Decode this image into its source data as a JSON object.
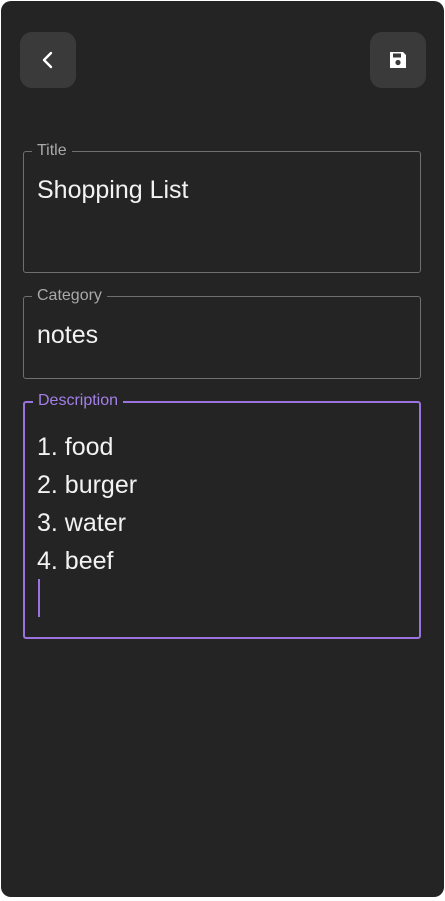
{
  "header": {
    "back_icon": "chevron-left-icon",
    "save_icon": "floppy-disk-icon"
  },
  "form": {
    "title": {
      "label": "Title",
      "value": "Shopping List"
    },
    "category": {
      "label": "Category",
      "value": "notes"
    },
    "description": {
      "label": "Description",
      "lines": [
        "1. food",
        "2. burger",
        "3. water",
        "4. beef"
      ]
    }
  },
  "colors": {
    "background": "#242424",
    "button_background": "#3a3a3a",
    "field_border": "#6f6f6f",
    "accent": "#9a73de",
    "text": "#f2f2f2",
    "label": "#a9a9a9"
  }
}
